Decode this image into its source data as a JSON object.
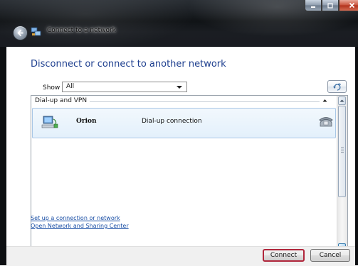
{
  "window": {
    "title": "Connect to a network",
    "controls": {
      "minimize": "minimize",
      "maximize": "maximize",
      "close": "close"
    }
  },
  "main": {
    "heading": "Disconnect or connect to another network",
    "show_label": "Show",
    "show_selected": "All",
    "group_header": "Dial-up and VPN",
    "connections": [
      {
        "name": "Orion",
        "type": "Dial-up connection",
        "selected": true
      }
    ]
  },
  "links": {
    "setup": "Set up a connection or network",
    "open_center": "Open Network and Sharing Center"
  },
  "footer": {
    "connect_label": "Connect",
    "cancel_label": "Cancel"
  },
  "icons": {
    "back": "back-arrow-icon",
    "network": "network-icon",
    "refresh": "refresh-icon",
    "connection": "dialup-computer-icon",
    "phone": "telephone-icon"
  },
  "colors": {
    "heading": "#1e3f8f",
    "link": "#1a4fa6",
    "selection_bg": "#e3f0fb",
    "connect_highlight": "#b0263b"
  }
}
